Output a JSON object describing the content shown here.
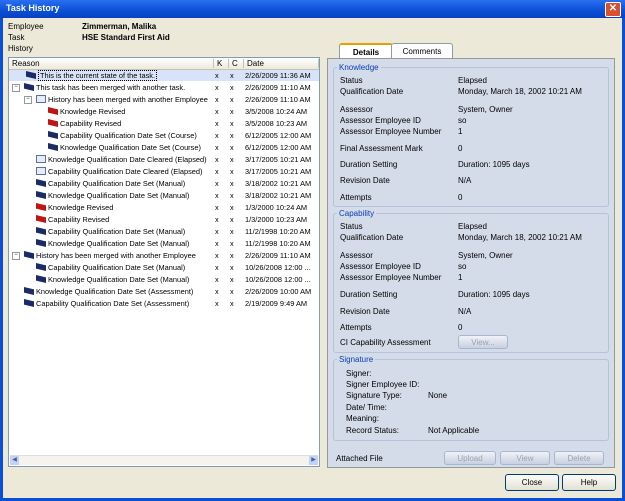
{
  "window": {
    "title": "Task History"
  },
  "header": {
    "employee_label": "Employee",
    "employee_value": "Zimmerman, Malika",
    "task_label": "Task",
    "task_value": "HSE Standard First Aid",
    "history_label": "History"
  },
  "tree": {
    "columns": {
      "reason": "Reason",
      "k": "K",
      "c": "C",
      "date": "Date"
    },
    "rows": [
      {
        "text": "This is the current state of the task.",
        "k": "x",
        "c": "x",
        "date": "2/26/2009 11:36 AM",
        "icon": "black-flag-icon"
      },
      {
        "text": "This task has been merged with another task.",
        "k": "x",
        "c": "x",
        "date": "2/26/2009 11:10 AM",
        "icon": "black-flag-icon"
      },
      {
        "text": "History has been merged with another Employee",
        "k": "x",
        "c": "x",
        "date": "2/26/2009 11:10 AM",
        "icon": "envelope-icon"
      },
      {
        "text": "Knowledge Revised",
        "k": "x",
        "c": "x",
        "date": "3/5/2008 10:24 AM",
        "icon": "red-flag-icon"
      },
      {
        "text": "Capability Revised",
        "k": "x",
        "c": "x",
        "date": "3/5/2008 10:23 AM",
        "icon": "red-flag-icon"
      },
      {
        "text": "Capability Qualification Date Set (Course)",
        "k": "x",
        "c": "x",
        "date": "6/12/2005 12:00 AM",
        "icon": "black-flag-icon"
      },
      {
        "text": "Knowledge Qualification Date Set (Course)",
        "k": "x",
        "c": "x",
        "date": "6/12/2005 12:00 AM",
        "icon": "black-flag-icon"
      },
      {
        "text": "Knowledge Qualification Date Cleared (Elapsed)",
        "k": "x",
        "c": "x",
        "date": "3/17/2005 10:21 AM",
        "icon": "envelope-icon"
      },
      {
        "text": "Capability Qualification Date Cleared (Elapsed)",
        "k": "x",
        "c": "x",
        "date": "3/17/2005 10:21 AM",
        "icon": "envelope-icon"
      },
      {
        "text": "Capability Qualification Date Set (Manual)",
        "k": "x",
        "c": "x",
        "date": "3/18/2002 10:21 AM",
        "icon": "black-flag-icon"
      },
      {
        "text": "Knowledge Qualification Date Set (Manual)",
        "k": "x",
        "c": "x",
        "date": "3/18/2002 10:21 AM",
        "icon": "black-flag-icon"
      },
      {
        "text": "Knowledge Revised",
        "k": "x",
        "c": "x",
        "date": "1/3/2000 10:24 AM",
        "icon": "red-flag-icon"
      },
      {
        "text": "Capability Revised",
        "k": "x",
        "c": "x",
        "date": "1/3/2000 10:23 AM",
        "icon": "red-flag-icon"
      },
      {
        "text": "Capability Qualification Date Set (Manual)",
        "k": "x",
        "c": "x",
        "date": "11/2/1998 10:20 AM",
        "icon": "black-flag-icon"
      },
      {
        "text": "Knowledge Qualification Date Set (Manual)",
        "k": "x",
        "c": "x",
        "date": "11/2/1998 10:20 AM",
        "icon": "black-flag-icon"
      },
      {
        "text": "History has been merged with another Employee",
        "k": "x",
        "c": "x",
        "date": "2/26/2009 11:10 AM",
        "icon": "black-flag-icon"
      },
      {
        "text": "Capability Qualification Date Set (Manual)",
        "k": "x",
        "c": "x",
        "date": "10/26/2008 12:00 ...",
        "icon": "black-flag-icon"
      },
      {
        "text": "Knowledge Qualification Date Set (Manual)",
        "k": "x",
        "c": "x",
        "date": "10/26/2008 12:00 ...",
        "icon": "black-flag-icon"
      },
      {
        "text": "Knowledge Qualification Date Set (Assessment)",
        "k": "x",
        "c": "x",
        "date": "2/26/2009 10:00 AM",
        "icon": "black-flag-icon"
      },
      {
        "text": "Capability Qualification Date Set (Assessment)",
        "k": "x",
        "c": "x",
        "date": "2/19/2009 9:49 AM",
        "icon": "black-flag-icon"
      }
    ]
  },
  "tabs": {
    "details": "Details",
    "comments": "Comments"
  },
  "knowledge": {
    "title": "Knowledge",
    "status_label": "Status",
    "status_value": "Elapsed",
    "qual_date_label": "Qualification Date",
    "qual_date_value": "Monday, March 18, 2002 10:21 AM",
    "assessor_label": "Assessor",
    "assessor_value": "System, Owner",
    "assessor_id_label": "Assessor Employee ID",
    "assessor_id_value": "so",
    "assessor_num_label": "Assessor Employee Number",
    "assessor_num_value": "1",
    "final_mark_label": "Final Assessment Mark",
    "final_mark_value": "0",
    "duration_label": "Duration Setting",
    "duration_value": "Duration: 1095 days",
    "revision_label": "Revision Date",
    "revision_value": "N/A",
    "attempts_label": "Attempts",
    "attempts_value": "0"
  },
  "capability": {
    "title": "Capability",
    "status_label": "Status",
    "status_value": "Elapsed",
    "qual_date_label": "Qualification Date",
    "qual_date_value": "Monday, March 18, 2002 10:21 AM",
    "assessor_label": "Assessor",
    "assessor_value": "System, Owner",
    "assessor_id_label": "Assessor Employee ID",
    "assessor_id_value": "so",
    "assessor_num_label": "Assessor Employee Number",
    "assessor_num_value": "1",
    "duration_label": "Duration Setting",
    "duration_value": "Duration: 1095 days",
    "revision_label": "Revision Date",
    "revision_value": "N/A",
    "attempts_label": "Attempts",
    "attempts_value": "0",
    "ci_label": "CI Capability Assessment",
    "view_label": "View..."
  },
  "signature": {
    "title": "Signature",
    "signer_label": "Signer:",
    "signer_id_label": "Signer Employee ID:",
    "type_label": "Signature Type:",
    "type_value": "None",
    "datetime_label": "Date/ Time:",
    "meaning_label": "Meaning:",
    "record_label": "Record Status:",
    "record_value": "Not Applicable"
  },
  "attached": {
    "label": "Attached File",
    "upload": "Upload",
    "view": "View",
    "delete": "Delete"
  },
  "footer": {
    "close": "Close",
    "help": "Help"
  }
}
